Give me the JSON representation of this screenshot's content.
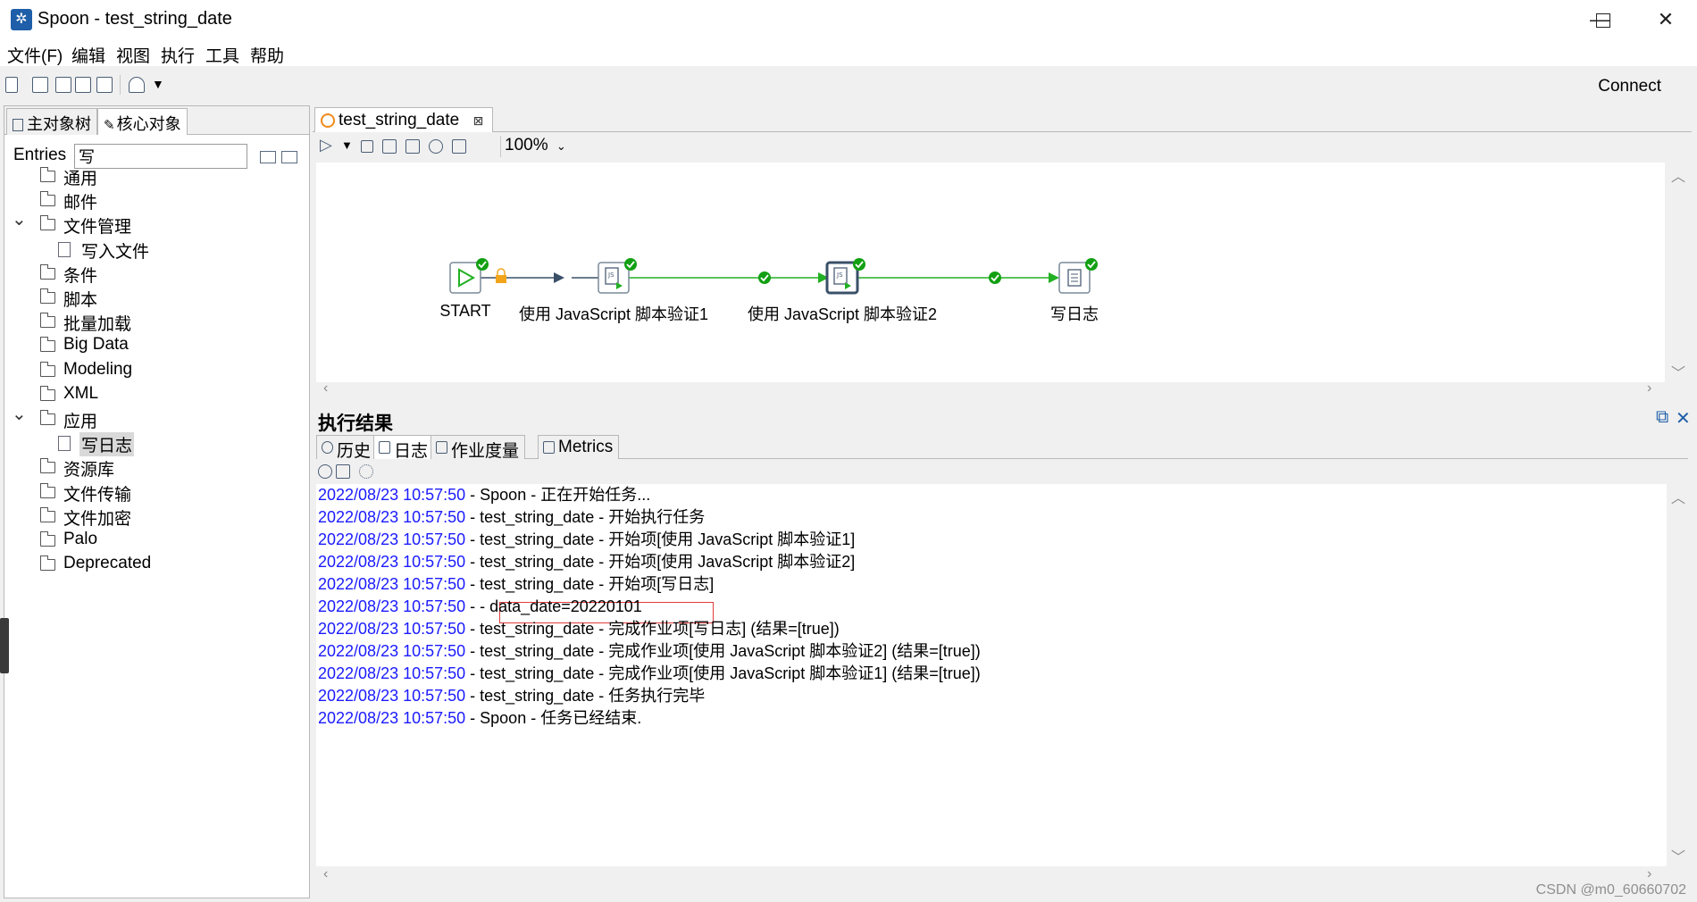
{
  "window": {
    "title": "Spoon - test_string_date",
    "minimize": "—",
    "maximize": "☐",
    "close": "✕"
  },
  "menu": [
    "文件(F)",
    "编辑",
    "视图",
    "执行",
    "工具",
    "帮助"
  ],
  "toolbar": {
    "connect_label": "Connect"
  },
  "left_panel": {
    "tabs": [
      "主对象树",
      "核心对象"
    ],
    "entries_label": "Entries",
    "search_value": "写",
    "tree": [
      {
        "label": "通用",
        "type": "folder"
      },
      {
        "label": "邮件",
        "type": "folder"
      },
      {
        "label": "文件管理",
        "type": "folder",
        "expanded": true
      },
      {
        "label": "写入文件",
        "type": "entry"
      },
      {
        "label": "条件",
        "type": "folder"
      },
      {
        "label": "脚本",
        "type": "folder"
      },
      {
        "label": "批量加载",
        "type": "folder"
      },
      {
        "label": "Big Data",
        "type": "folder"
      },
      {
        "label": "Modeling",
        "type": "folder"
      },
      {
        "label": "XML",
        "type": "folder"
      },
      {
        "label": "应用",
        "type": "folder",
        "expanded": true
      },
      {
        "label": "写日志",
        "type": "entry",
        "selected": true
      },
      {
        "label": "资源库",
        "type": "folder"
      },
      {
        "label": "文件传输",
        "type": "folder"
      },
      {
        "label": "文件加密",
        "type": "folder"
      },
      {
        "label": "Palo",
        "type": "folder"
      },
      {
        "label": "Deprecated",
        "type": "folder"
      }
    ]
  },
  "editor": {
    "tab_label": "test_string_date",
    "tab_close": "⊠",
    "zoom": "100%",
    "nodes": [
      {
        "label": "START"
      },
      {
        "label": "使用 JavaScript 脚本验证1"
      },
      {
        "label": "使用 JavaScript 脚本验证2"
      },
      {
        "label": "写日志"
      }
    ]
  },
  "results": {
    "title": "执行结果",
    "tabs": [
      "历史",
      "日志",
      "作业度量",
      "Metrics"
    ],
    "log": [
      {
        "ts": "2022/08/23 10:57:50",
        "msg": " - Spoon - 正在开始任务..."
      },
      {
        "ts": "2022/08/23 10:57:50",
        "msg": " - test_string_date - 开始执行任务"
      },
      {
        "ts": "2022/08/23 10:57:50",
        "msg": " - test_string_date - 开始项[使用 JavaScript 脚本验证1]"
      },
      {
        "ts": "2022/08/23 10:57:50",
        "msg": " - test_string_date - 开始项[使用 JavaScript 脚本验证2]"
      },
      {
        "ts": "2022/08/23 10:57:50",
        "msg": " - test_string_date - 开始项[写日志]"
      },
      {
        "ts": "2022/08/23 10:57:50",
        "msg": " - - data_date=20220101"
      },
      {
        "ts": "2022/08/23 10:57:50",
        "msg": " - test_string_date - 完成作业项[写日志] (结果=[true])"
      },
      {
        "ts": "2022/08/23 10:57:50",
        "msg": " - test_string_date - 完成作业项[使用 JavaScript 脚本验证2] (结果=[true])"
      },
      {
        "ts": "2022/08/23 10:57:50",
        "msg": " - test_string_date - 完成作业项[使用 JavaScript 脚本验证1] (结果=[true])"
      },
      {
        "ts": "2022/08/23 10:57:50",
        "msg": " - test_string_date - 任务执行完毕"
      },
      {
        "ts": "2022/08/23 10:57:50",
        "msg": " - Spoon - 任务已经结束."
      }
    ]
  },
  "watermark": "CSDN @m0_60660702",
  "colors": {
    "timestamp": "#1a1aff",
    "hop_green": "#22b022",
    "hop_gray": "#3a5068",
    "check_green": "#12a012",
    "highlight": "#e23b3b"
  }
}
